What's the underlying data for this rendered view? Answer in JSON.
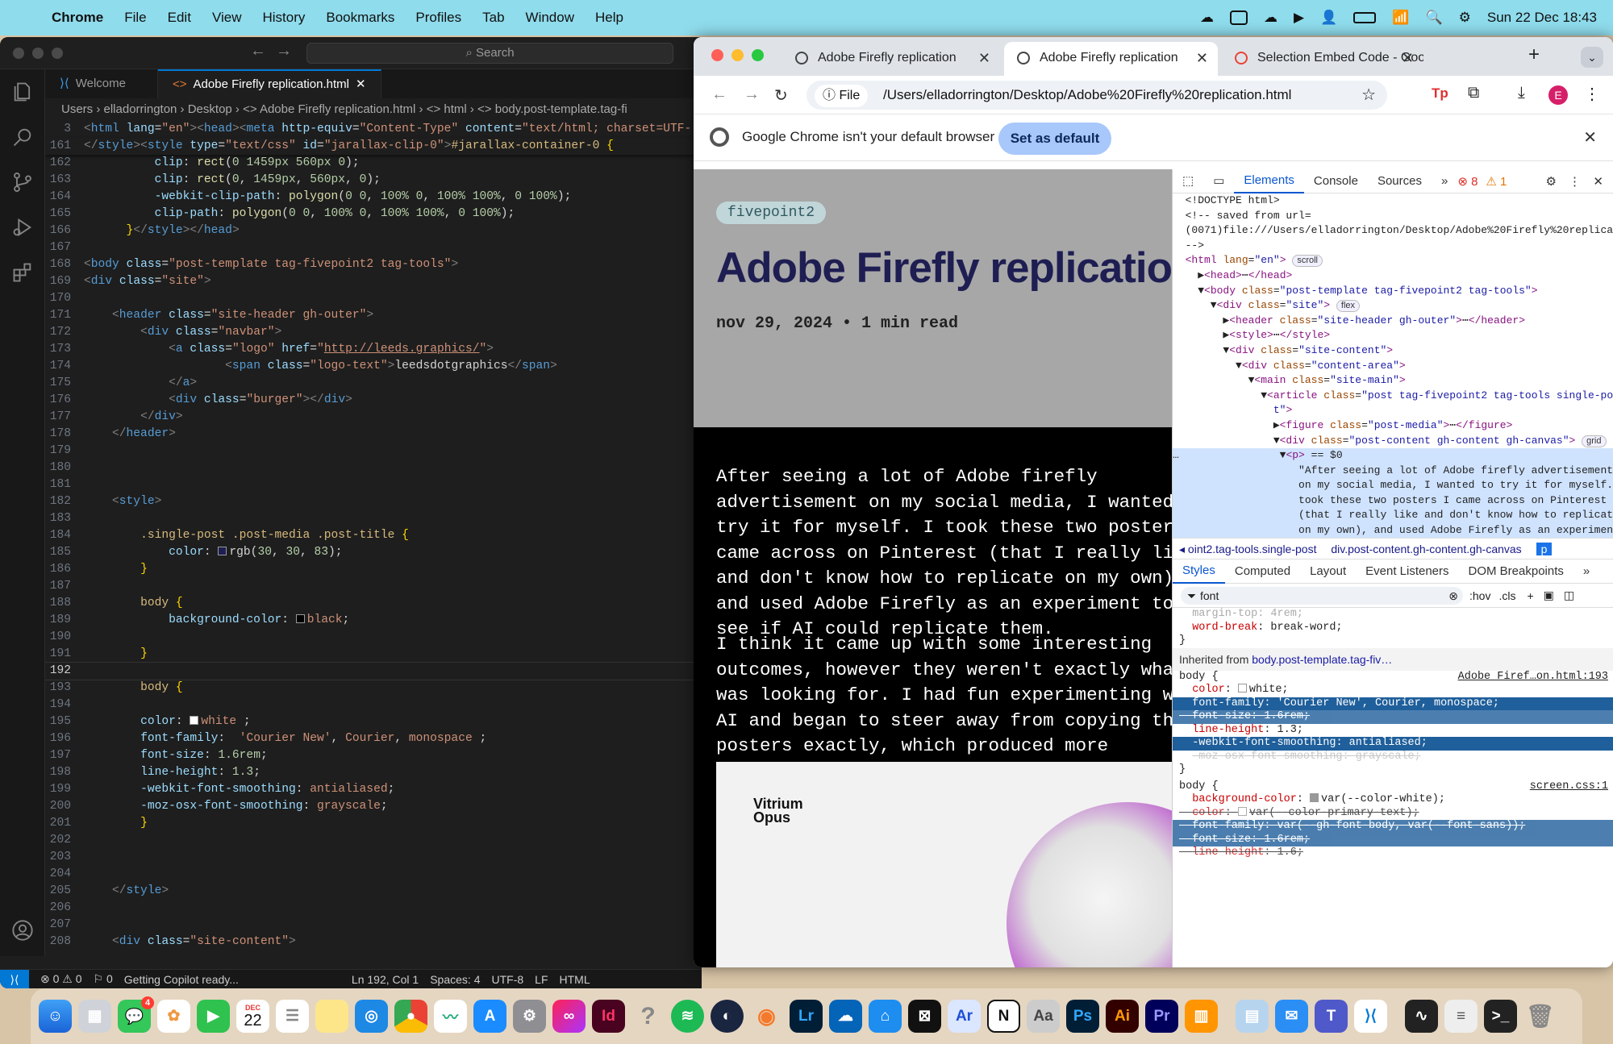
{
  "menubar": {
    "items": [
      "Chrome",
      "File",
      "Edit",
      "View",
      "History",
      "Bookmarks",
      "Profiles",
      "Tab",
      "Window",
      "Help"
    ],
    "clock": "Sun 22 Dec  18:43"
  },
  "vscode": {
    "search_placeholder": "Search",
    "tabs": [
      {
        "label": "Welcome"
      },
      {
        "label": "Adobe Firefly replication.html"
      }
    ],
    "breadcrumb": "Users  ›  elladorrington  ›  Desktop  ›  <> Adobe Firefly replication.html  ›  <> html  ›  <> body.post-template.tag-fi",
    "status": {
      "problems": "⊗ 0 ⚠ 0",
      "ports": "⚐ 0",
      "copilot": "Getting Copilot ready...",
      "position": "Ln 192, Col 1",
      "spaces": "Spaces: 4",
      "encoding": "UTF-8",
      "eol": "LF",
      "language": "HTML"
    }
  },
  "chrome": {
    "tabs": [
      {
        "title": "Adobe Firefly replication"
      },
      {
        "title": "Adobe Firefly replication"
      },
      {
        "title": "Selection Embed Code - Goo"
      }
    ],
    "file_chip": "File",
    "url": "/Users/elladorrington/Desktop/Adobe%20Firefly%20replication.html",
    "profile_initial": "E",
    "infobar": {
      "message": "Google Chrome isn't your default browser",
      "button": "Set as default"
    },
    "page": {
      "tag": "fivepoint2",
      "title": "Adobe Firefly replication",
      "date": "nov 29, 2024 • 1 min read",
      "paragraph1": "After seeing a lot of Adobe firefly\nadvertisement on my social media, I wanted to\ntry it for myself. I took these two posters I\ncame across on Pinterest (that I really like\nand don't know how to replicate on my own),\nand used Adobe Firefly as an experiment to\nsee if AI could replicate them.",
      "paragraph2": "I think it came up with some interesting\noutcomes, however they weren't exactly what I\nwas looking for. I had fun experimenting with\nAI and began to steer away from copying the\nposters exactly, which produced more\nintriguing results.",
      "poster_logo": "Vitrium\nOpus"
    }
  },
  "devtools": {
    "tabs": [
      "Elements",
      "Console",
      "Sources"
    ],
    "errors": "8",
    "warnings": "1",
    "crumbs": [
      "oint2.tag-tools.single-post",
      "div.post-content.gh-content.gh-canvas",
      "p"
    ],
    "style_tabs": [
      "Styles",
      "Computed",
      "Layout",
      "Event Listeners",
      "DOM Breakpoints"
    ],
    "filter_value": "font",
    "filter_options": [
      ":hov",
      ".cls"
    ],
    "inherited_label": "Inherited from",
    "inherited_from": "body.post-template.tag-fiv…",
    "rule1_source": "Adobe Firef…on.html:193",
    "rule2_source": "screen.css:1"
  },
  "dock": {
    "apps": [
      "finder",
      "launchpad",
      "messages",
      "photos",
      "facetime",
      "calendar",
      "reminders",
      "notes",
      "safari",
      "chrome",
      "freeform",
      "app-store",
      "system-settings",
      "creative-cloud",
      "indesign",
      "help",
      "spotify",
      "cinema4d",
      "blender",
      "lightroom",
      "onedrive",
      "keynote",
      "capcut",
      "arc",
      "notion",
      "font-book",
      "photoshop",
      "illustrator",
      "premiere",
      "books",
      "preview",
      "mail",
      "teams",
      "vscode",
      "activity-monitor",
      "textedit",
      "terminal",
      "trash"
    ],
    "calendar_month": "DEC",
    "calendar_day": "22",
    "messages_badge": "4"
  }
}
